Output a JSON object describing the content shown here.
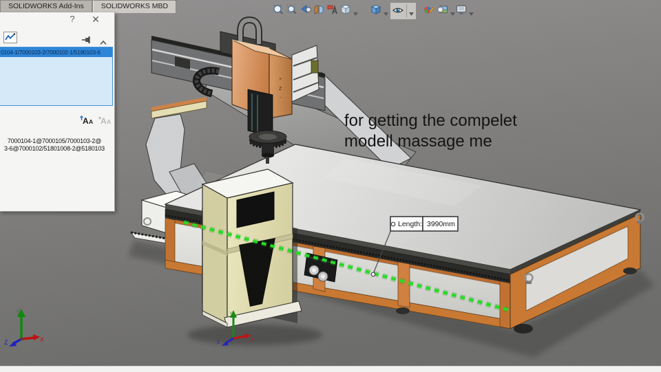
{
  "window": {
    "tabs": [
      {
        "label": "SOLIDWORKS Add-Ins",
        "active": false
      },
      {
        "label": "SOLIDWORKS MBD",
        "active": true
      }
    ]
  },
  "hud_toolbar": {
    "icons": [
      "zoom-to-fit",
      "zoom-to-area",
      "previous-view",
      "section-view",
      "annotation-views",
      "view-orientation",
      "display-style",
      "hide-show-items",
      "edit-appearance",
      "apply-scene",
      "view-settings"
    ]
  },
  "measure_dialog": {
    "help_label": "?",
    "close_label": "✕",
    "icons": [
      "measurement-history",
      "pin",
      "collapse-chevron",
      "font-increase",
      "font-decrease"
    ],
    "font_icon_glyph": "A",
    "selection_list": {
      "items": [
        {
          "text": "0104-1/7000103-2/7000102-1/5180103-6",
          "selected": true
        }
      ]
    },
    "results": {
      "line1": "7000104-1@7000105/7000103-2@",
      "line2": "3-6@7000102/51801008-2@5180103"
    }
  },
  "viewport": {
    "annotation": {
      "line1": "for getting the compelet",
      "line2": "modell massage me"
    },
    "measure_callout": {
      "label": "Length:",
      "value": "3990mm"
    },
    "origin_triad": {
      "x": "X",
      "y": "Y",
      "z": "Z"
    },
    "view_triad": {
      "x": "X",
      "y": "Y",
      "z": "Z"
    },
    "head_markings": {
      "plus": "+",
      "z": "Z",
      "minus": "-"
    },
    "colors": {
      "highlight_green": "#1fd41f",
      "frame_orange": "#c9762f",
      "head_copper": "#dd9d68",
      "cabinet_cream": "#e3dfb3",
      "table_silver": "#d7d8d6",
      "background_gray": "#7e7d7b"
    }
  }
}
